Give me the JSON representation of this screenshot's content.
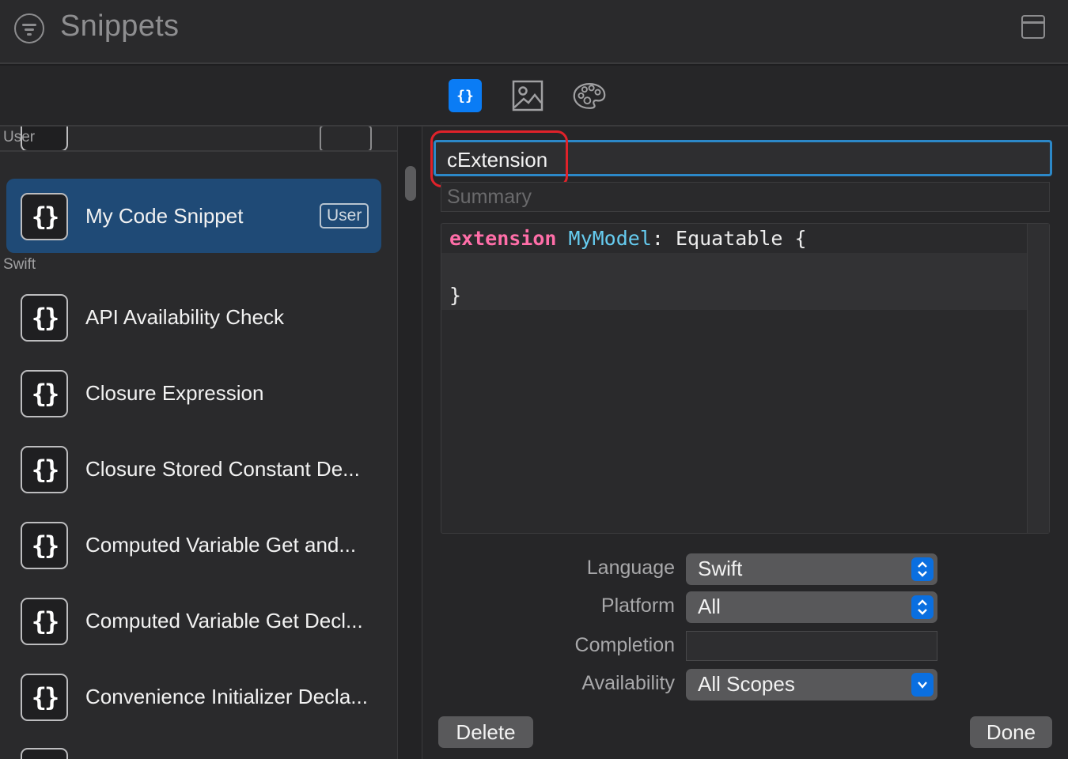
{
  "window": {
    "title": "Snippets",
    "filter_icon": "line-3-horizontal-decrease-circle-icon",
    "layout_icon": "sidebar-window-icon"
  },
  "toolbar": {
    "tabs": [
      {
        "icon": "curly-braces-icon",
        "label": "{}",
        "selected": true
      },
      {
        "icon": "photo-icon",
        "selected": false
      },
      {
        "icon": "palette-icon",
        "selected": false
      }
    ]
  },
  "sidebar": {
    "sections": [
      {
        "header": "User",
        "items": [
          {
            "icon": "code-snippet-icon",
            "icon_glyph": "{}",
            "label": "My Code Snippet",
            "badge": "User",
            "selected": true
          }
        ]
      },
      {
        "header": "Swift",
        "items": [
          {
            "icon": "code-snippet-icon",
            "icon_glyph": "{}",
            "label": "API Availability Check"
          },
          {
            "icon": "code-snippet-icon",
            "icon_glyph": "{}",
            "label": "Closure Expression"
          },
          {
            "icon": "code-snippet-icon",
            "icon_glyph": "{}",
            "label": "Closure Stored Constant De..."
          },
          {
            "icon": "code-snippet-icon",
            "icon_glyph": "{}",
            "label": "Computed Variable Get and..."
          },
          {
            "icon": "code-snippet-icon",
            "icon_glyph": "{}",
            "label": "Computed Variable Get Decl..."
          },
          {
            "icon": "code-snippet-icon",
            "icon_glyph": "{}",
            "label": "Convenience Initializer Decla..."
          }
        ]
      }
    ]
  },
  "editor": {
    "name_value": "cExtension",
    "summary_placeholder": "Summary",
    "code": {
      "keyword": "extension",
      "type": "MyModel",
      "rest": ": Equatable {",
      "closing": "}"
    },
    "language_label": "Language",
    "language_value": "Swift",
    "platform_label": "Platform",
    "platform_value": "All",
    "completion_label": "Completion",
    "completion_value": "",
    "availability_label": "Availability",
    "availability_value": "All Scopes",
    "delete_label": "Delete",
    "done_label": "Done"
  },
  "colors": {
    "accent": "#0a7cf5",
    "selection": "#1f4a76",
    "focus_ring": "#2c88c8",
    "highlight_annotation": "#e0222a",
    "keyword": "#ff6ea8",
    "type": "#66ccf0"
  }
}
